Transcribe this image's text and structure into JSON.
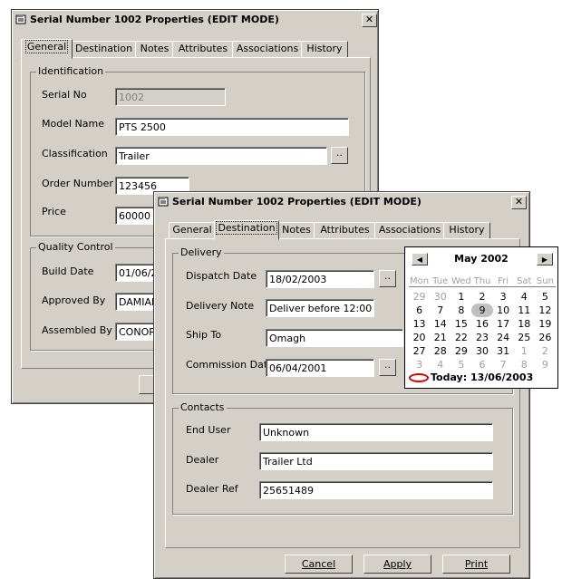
{
  "back_window": {
    "title": "Serial Number 1002 Properties (EDIT MODE)",
    "tabs": [
      "General",
      "Destination",
      "Notes",
      "Attributes",
      "Associations",
      "History"
    ],
    "active_tab": "General",
    "identification": {
      "legend": "Identification",
      "serial_no_label": "Serial No",
      "serial_no_value": "1002",
      "model_name_label": "Model Name",
      "model_name_value": "PTS 2500",
      "classification_label": "Classification",
      "classification_value": "Trailer",
      "order_number_label": "Order Number",
      "order_number_value": "123456",
      "price_label": "Price",
      "price_value": "60000"
    },
    "quality_control": {
      "legend": "Quality Control",
      "build_date_label": "Build Date",
      "build_date_value": "01/06/20",
      "approved_by_label": "Approved By",
      "approved_by_value": "DAMIAN",
      "assembled_by_label": "Assembled By",
      "assembled_by_value": "CONOR"
    },
    "ellipsis": ".."
  },
  "front_window": {
    "title": "Serial Number 1002 Properties (EDIT MODE)",
    "tabs": [
      "General",
      "Destination",
      "Notes",
      "Attributes",
      "Associations",
      "History"
    ],
    "active_tab": "Destination",
    "delivery": {
      "legend": "Delivery",
      "dispatch_date_label": "Dispatch Date",
      "dispatch_date_value": "18/02/2003",
      "delivery_note_label": "Delivery Note",
      "delivery_note_value": "Deliver before 12:00",
      "ship_to_label": "Ship To",
      "ship_to_value": "Omagh",
      "commission_date_label": "Commission Date",
      "commission_date_value": "06/04/2001"
    },
    "contacts": {
      "legend": "Contacts",
      "end_user_label": "End User",
      "end_user_value": "Unknown",
      "dealer_label": "Dealer",
      "dealer_value": "Trailer Ltd",
      "dealer_ref_label": "Dealer Ref",
      "dealer_ref_value": "25651489"
    },
    "buttons": {
      "cancel": "Cancel",
      "apply": "Apply",
      "print": "Print"
    },
    "ellipsis": ".."
  },
  "calendar": {
    "month_label": "May 2002",
    "weekdays": [
      "Mon",
      "Tue",
      "Wed",
      "Thu",
      "Fri",
      "Sat",
      "Sun"
    ],
    "days": [
      "29",
      "30",
      "1",
      "2",
      "3",
      "4",
      "5",
      "6",
      "7",
      "8",
      "9",
      "10",
      "11",
      "12",
      "13",
      "14",
      "15",
      "16",
      "17",
      "18",
      "19",
      "20",
      "21",
      "22",
      "23",
      "24",
      "25",
      "26",
      "27",
      "28",
      "29",
      "30",
      "31",
      "1",
      "2",
      "3",
      "4",
      "5",
      "6",
      "7",
      "8",
      "9"
    ],
    "selected_day": "9",
    "today_label": "Today: 13/06/2003"
  },
  "icons": {
    "window": "property-sheet-icon",
    "close": "close-icon",
    "prev": "arrow-left-icon",
    "next": "arrow-right-icon",
    "today": "today-ring-icon"
  }
}
